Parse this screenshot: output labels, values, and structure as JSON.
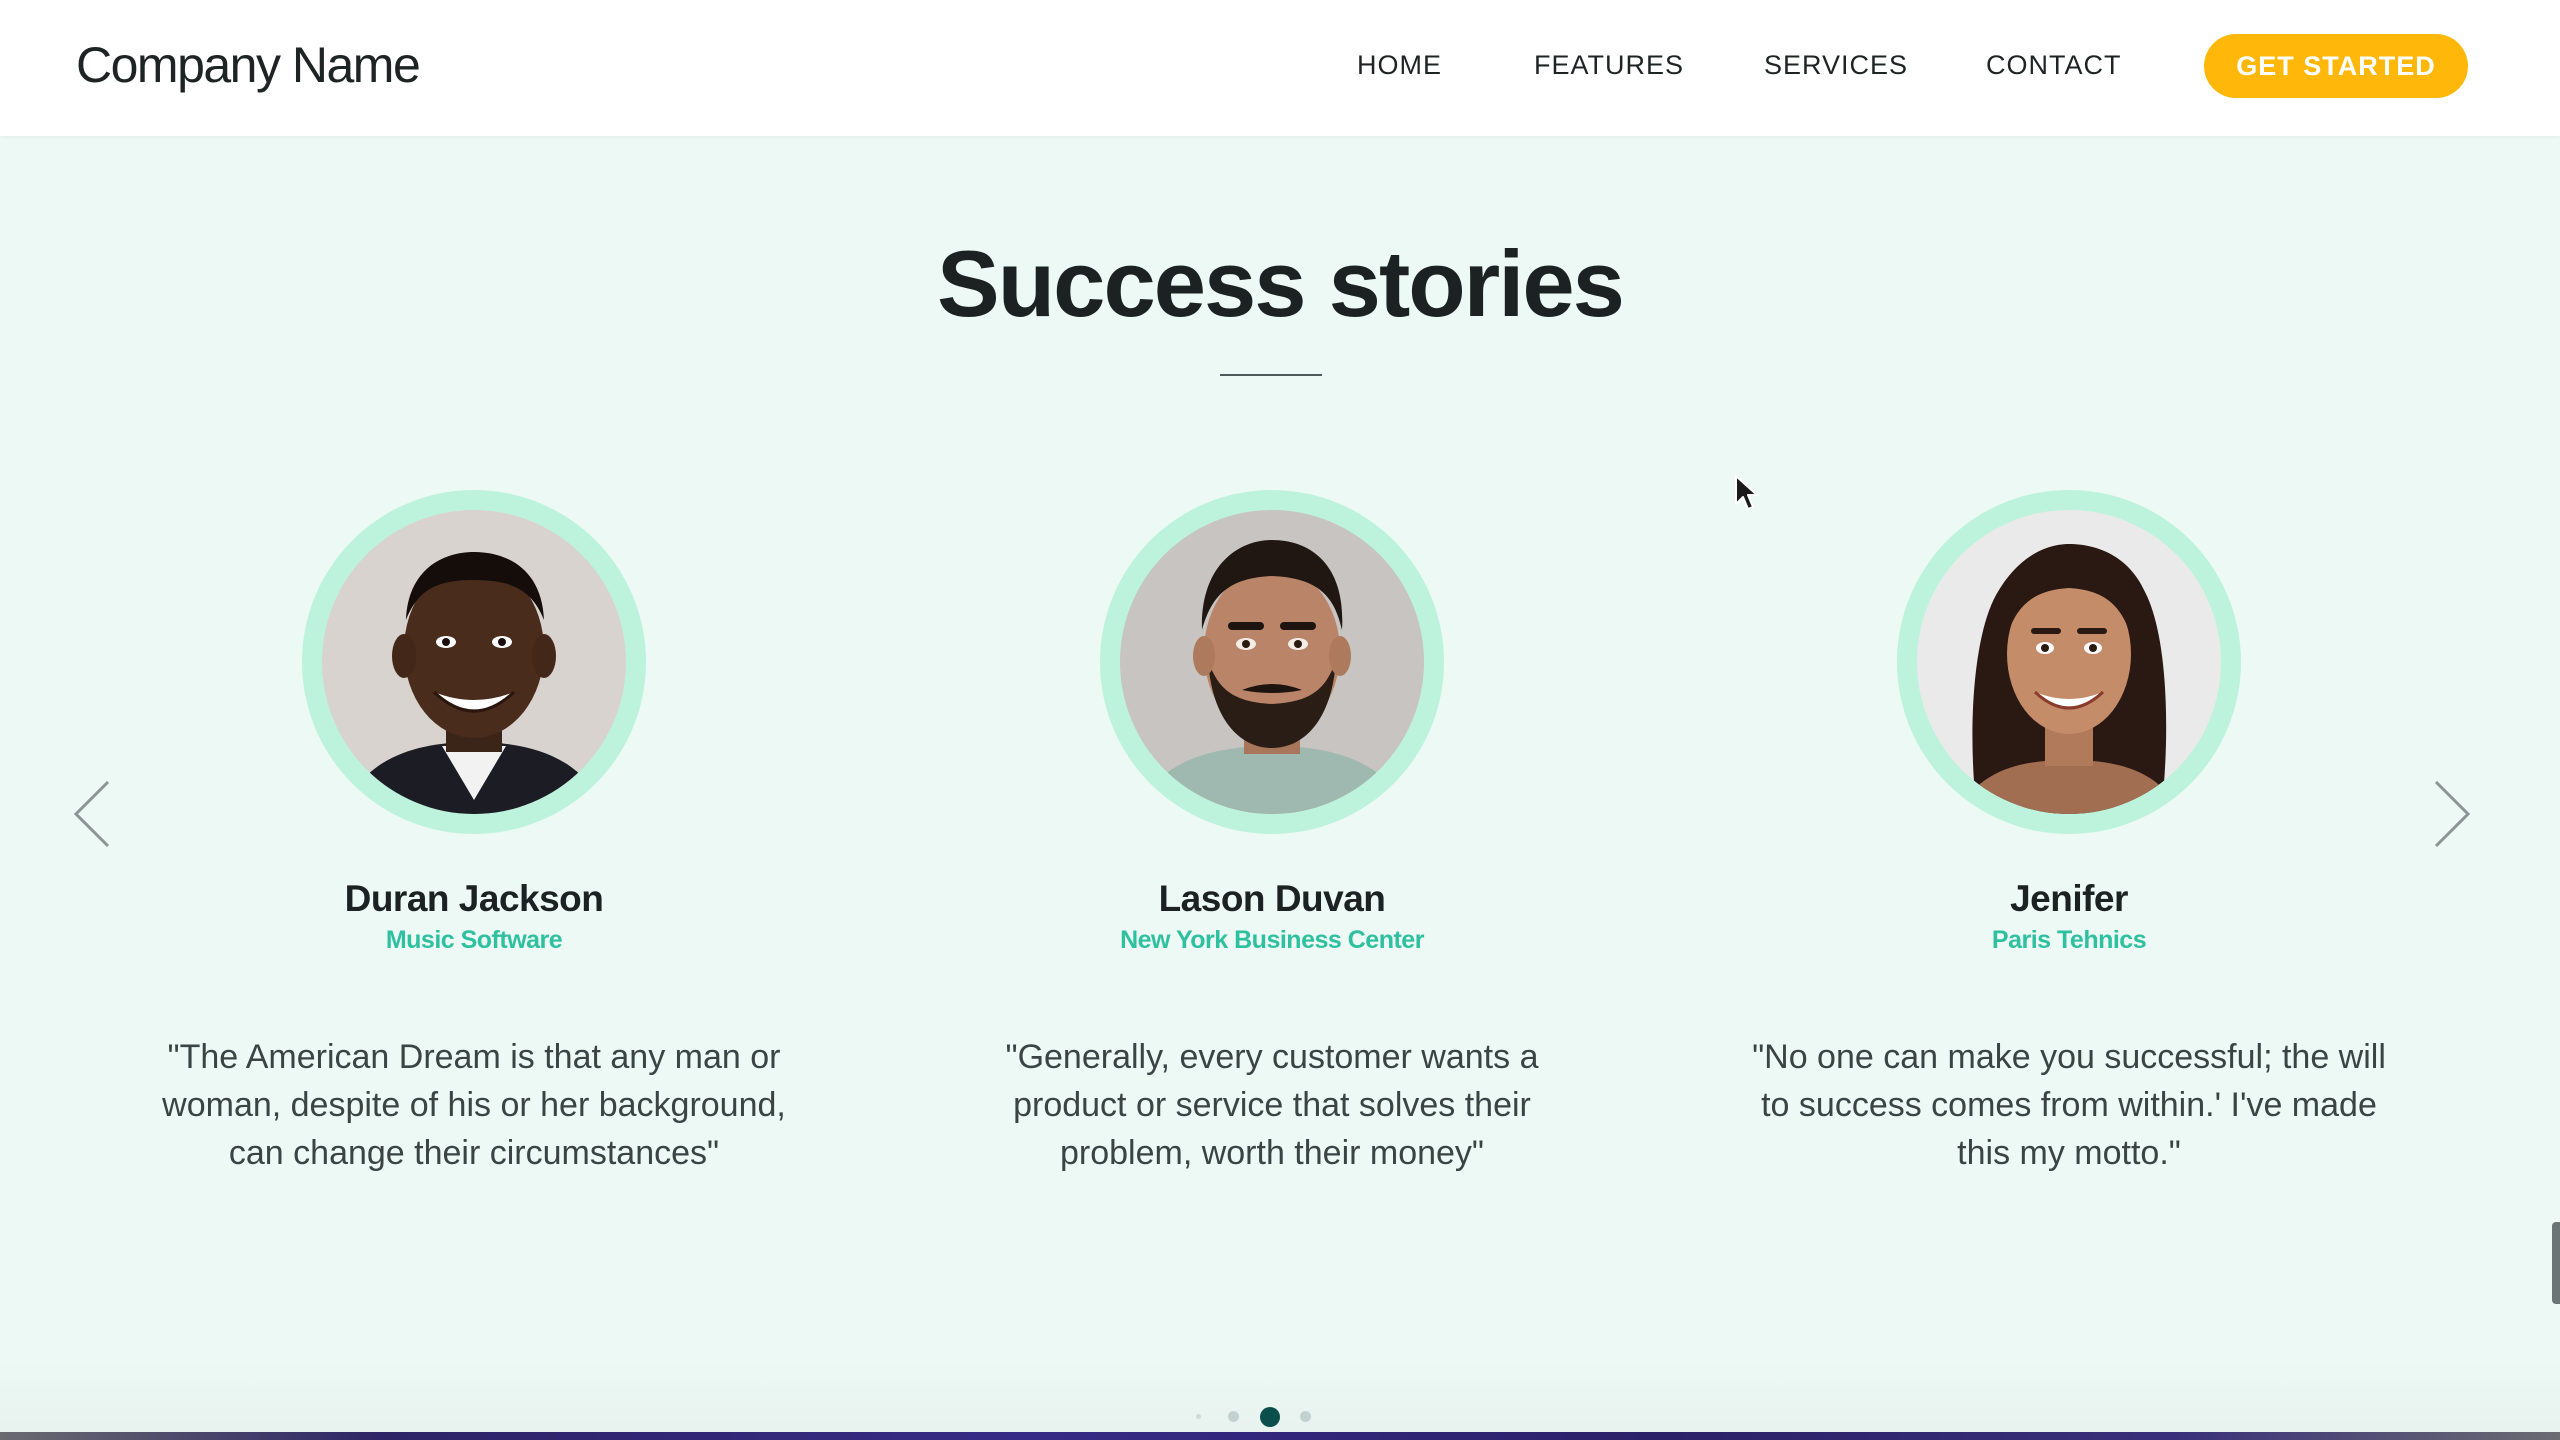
{
  "header": {
    "brand": "Company Name",
    "nav": [
      "HOME",
      "FEATURES",
      "SERVICES",
      "CONTACT"
    ],
    "cta_label": "GET STARTED"
  },
  "section": {
    "title": "Success stories"
  },
  "testimonials": [
    {
      "name": "Duran Jackson",
      "company": "Music Software",
      "quote": "\"The American Dream is that any man or woman, despite of his or her background, can change their circumstances\""
    },
    {
      "name": "Lason Duvan",
      "company": "New York Business Center",
      "quote": "\"Generally, every customer wants a product or service that solves their problem, worth their money\""
    },
    {
      "name": "Jenifer",
      "company": "Paris Tehnics",
      "quote": "\"No one can make you successful; the will to success comes from within.' I've made this my motto.\""
    }
  ],
  "carousel": {
    "active_dot": 3,
    "dot_count": 4
  },
  "colors": {
    "accent": "#ffb80a",
    "teal": "#2fc0a0",
    "ring": "#bdf3dc",
    "background": "#ecf9f4"
  },
  "icons": {
    "prev": "chevron-left-icon",
    "next": "chevron-right-icon"
  }
}
